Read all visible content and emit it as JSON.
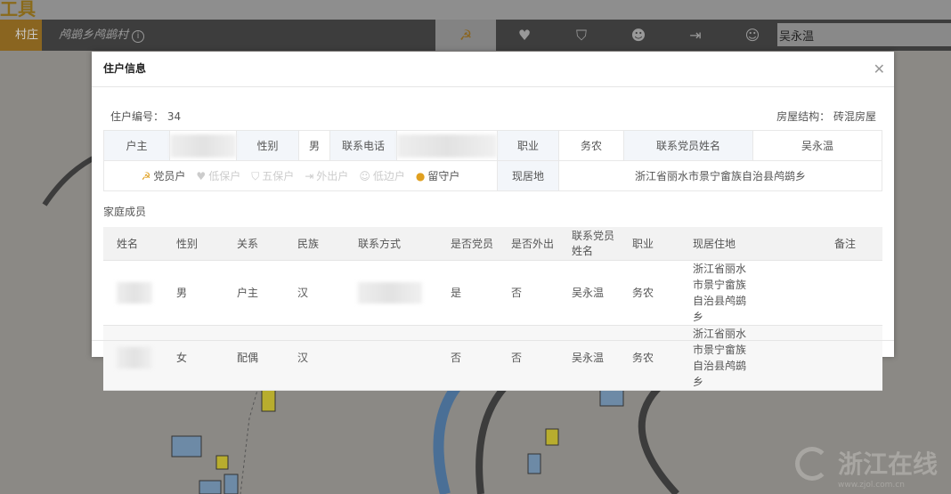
{
  "header": {
    "logo": "工具",
    "nav_tab": "村庄",
    "breadcrumb": "鸬鹚乡鸬鹚村",
    "icons": [
      "party-icon",
      "heart-icon",
      "shield-user-icon",
      "smile-icon",
      "exit-door-icon",
      "child-face-icon"
    ],
    "search_value": "吴永温"
  },
  "modal": {
    "title": "住户信息",
    "household_no_label": "住户编号：",
    "household_no": "34",
    "house_structure_label": "房屋结构：",
    "house_structure": "砖混房屋",
    "info": {
      "head_label": "户主",
      "gender_label": "性别",
      "gender": "男",
      "phone_label": "联系电话",
      "job_label": "职业",
      "job": "务农",
      "contact_party_label": "联系党员姓名",
      "contact_party": "吴永温",
      "residence_label": "现居地",
      "residence": "浙江省丽水市景宁畲族自治县鸬鹚乡"
    },
    "tags": [
      {
        "label": "党员户",
        "active": true,
        "icon": "☭"
      },
      {
        "label": "低保户",
        "active": false,
        "icon": "♥"
      },
      {
        "label": "五保户",
        "active": false,
        "icon": "⛉"
      },
      {
        "label": "外出户",
        "active": false,
        "icon": "⇥"
      },
      {
        "label": "低边户",
        "active": false,
        "icon": "☺"
      },
      {
        "label": "留守户",
        "active": true,
        "icon": "●"
      }
    ],
    "members_title": "家庭成员",
    "columns": [
      "姓名",
      "性别",
      "关系",
      "民族",
      "联系方式",
      "是否党员",
      "是否外出",
      "联系党员姓名",
      "职业",
      "现居住地",
      "备注"
    ],
    "rows": [
      {
        "gender": "男",
        "relation": "户主",
        "ethnicity": "汉",
        "party": "是",
        "away": "否",
        "contact": "吴永温",
        "job": "务农",
        "address": "浙江省丽水市景宁畲族自治县鸬鹚乡",
        "note": ""
      },
      {
        "gender": "女",
        "relation": "配偶",
        "ethnicity": "汉",
        "party": "否",
        "away": "否",
        "contact": "吴永温",
        "job": "务农",
        "address": "浙江省丽水市景宁畲族自治县鸬鹚乡",
        "note": ""
      }
    ]
  },
  "watermark": {
    "name": "浙江在线",
    "url": "www.zjol.com.cn"
  }
}
